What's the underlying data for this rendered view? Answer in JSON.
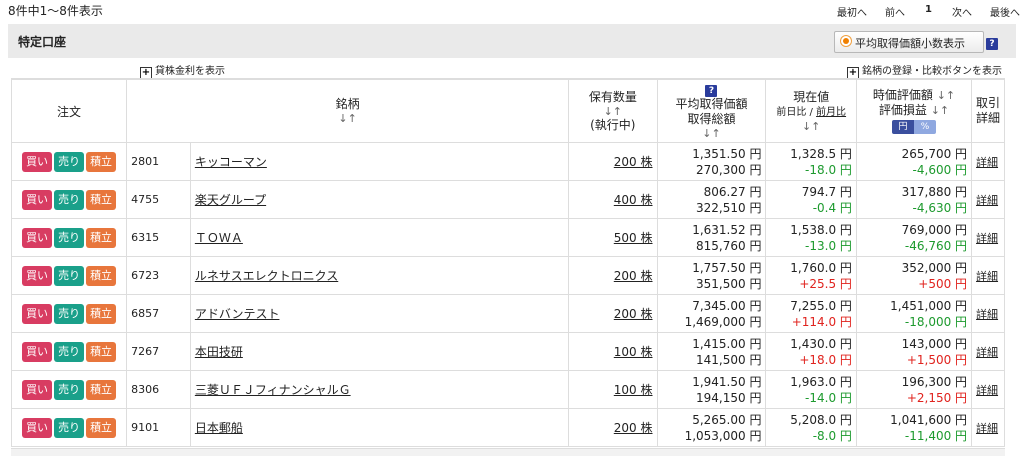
{
  "top": {
    "count_text": "8件中1～8件表示",
    "pager": {
      "first": "最初へ",
      "prev": "前へ",
      "current": "1",
      "next": "次へ",
      "last": "最後へ"
    }
  },
  "account": {
    "title": "特定口座",
    "avg_toggle_label": "平均取得価額小数表示",
    "help_glyph": "?"
  },
  "links": {
    "lending_rate": "貸株金利を表示",
    "register_compare": "銘柄の登録・比較ボタンを表示"
  },
  "headers": {
    "order": "注文",
    "stock": "銘柄",
    "holding": "保有数量",
    "holding_sub": "(執行中)",
    "avg_price": "平均取得価額",
    "total_cost": "取得総額",
    "current": "現在値",
    "day_change": "前日比",
    "month_change": "前月比",
    "valuation": "時価評価額",
    "pnl": "評価損益",
    "unit_yen": "円",
    "unit_pct": "%",
    "trade": "取引",
    "trade_detail": "詳細",
    "sort": "↓↑",
    "slash": " / "
  },
  "buttons": {
    "buy": "買い",
    "sell": "売り",
    "accum": "積立"
  },
  "rows": [
    {
      "code": "2801",
      "name": "キッコーマン",
      "qty": "200 株",
      "avg": "1,351.50 円",
      "cost": "270,300 円",
      "price": "1,328.5 円",
      "change": "-18.0 円",
      "value": "265,700 円",
      "pnl": "-4,600 円",
      "detail": "詳細"
    },
    {
      "code": "4755",
      "name": "楽天グループ",
      "qty": "400 株",
      "avg": "806.27 円",
      "cost": "322,510 円",
      "price": "794.7 円",
      "change": "-0.4 円",
      "value": "317,880 円",
      "pnl": "-4,630 円",
      "detail": "詳細"
    },
    {
      "code": "6315",
      "name": "ＴＯＷＡ",
      "qty": "500 株",
      "avg": "1,631.52 円",
      "cost": "815,760 円",
      "price": "1,538.0 円",
      "change": "-13.0 円",
      "value": "769,000 円",
      "pnl": "-46,760 円",
      "detail": "詳細"
    },
    {
      "code": "6723",
      "name": "ルネサスエレクトロニクス",
      "qty": "200 株",
      "avg": "1,757.50 円",
      "cost": "351,500 円",
      "price": "1,760.0 円",
      "change": "+25.5 円",
      "value": "352,000 円",
      "pnl": "+500 円",
      "detail": "詳細"
    },
    {
      "code": "6857",
      "name": "アドバンテスト",
      "qty": "200 株",
      "avg": "7,345.00 円",
      "cost": "1,469,000 円",
      "price": "7,255.0 円",
      "change": "+114.0 円",
      "value": "1,451,000 円",
      "pnl": "-18,000 円",
      "detail": "詳細"
    },
    {
      "code": "7267",
      "name": "本田技研",
      "qty": "100 株",
      "avg": "1,415.00 円",
      "cost": "141,500 円",
      "price": "1,430.0 円",
      "change": "+18.0 円",
      "value": "143,000 円",
      "pnl": "+1,500 円",
      "detail": "詳細"
    },
    {
      "code": "8306",
      "name": "三菱ＵＦＪフィナンシャルＧ",
      "qty": "100 株",
      "avg": "1,941.50 円",
      "cost": "194,150 円",
      "price": "1,963.0 円",
      "change": "-14.0 円",
      "value": "196,300 円",
      "pnl": "+2,150 円",
      "detail": "詳細"
    },
    {
      "code": "9101",
      "name": "日本郵船",
      "qty": "200 株",
      "avg": "5,265.00 円",
      "cost": "1,053,000 円",
      "price": "5,208.0 円",
      "change": "-8.0 円",
      "value": "1,041,600 円",
      "pnl": "-11,400 円",
      "detail": "詳細"
    }
  ],
  "colors": {
    "buy": "#d83c62",
    "sell": "#1aa08a",
    "accum": "#e8763c",
    "negative": "#1d9a2e",
    "positive": "#e0231e"
  }
}
